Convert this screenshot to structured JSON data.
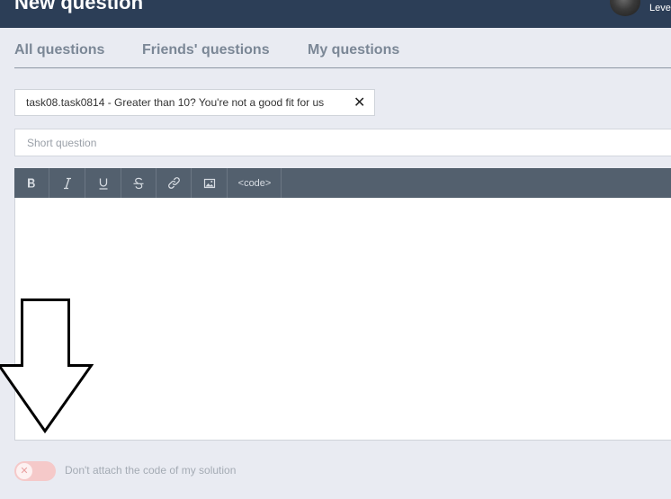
{
  "header": {
    "title": "New question",
    "level_label": "Level"
  },
  "tabs": [
    {
      "label": "All questions"
    },
    {
      "label": "Friends' questions"
    },
    {
      "label": "My questions"
    }
  ],
  "task_chip": {
    "label": "task08.task0814 - Greater than 10? You're not a good fit for us",
    "close": "✕"
  },
  "short_question": {
    "placeholder": "Short question",
    "value": ""
  },
  "toolbar": {
    "buttons": [
      {
        "icon": "bold-icon"
      },
      {
        "icon": "italic-icon"
      },
      {
        "icon": "underline-icon"
      },
      {
        "icon": "strikethrough-icon"
      },
      {
        "icon": "link-icon"
      },
      {
        "icon": "image-icon"
      },
      {
        "icon": "code-icon",
        "label": "<code>"
      }
    ]
  },
  "attach_toggle": {
    "state": "off",
    "knob_symbol": "✕",
    "label": "Don't attach the code of my solution"
  },
  "colors": {
    "header_bg": "#2c3e57",
    "page_bg": "#e9ebf2",
    "toolbar_bg": "#53606e",
    "tab_text": "#7b8796",
    "toggle_bg": "#f5c9c9"
  }
}
